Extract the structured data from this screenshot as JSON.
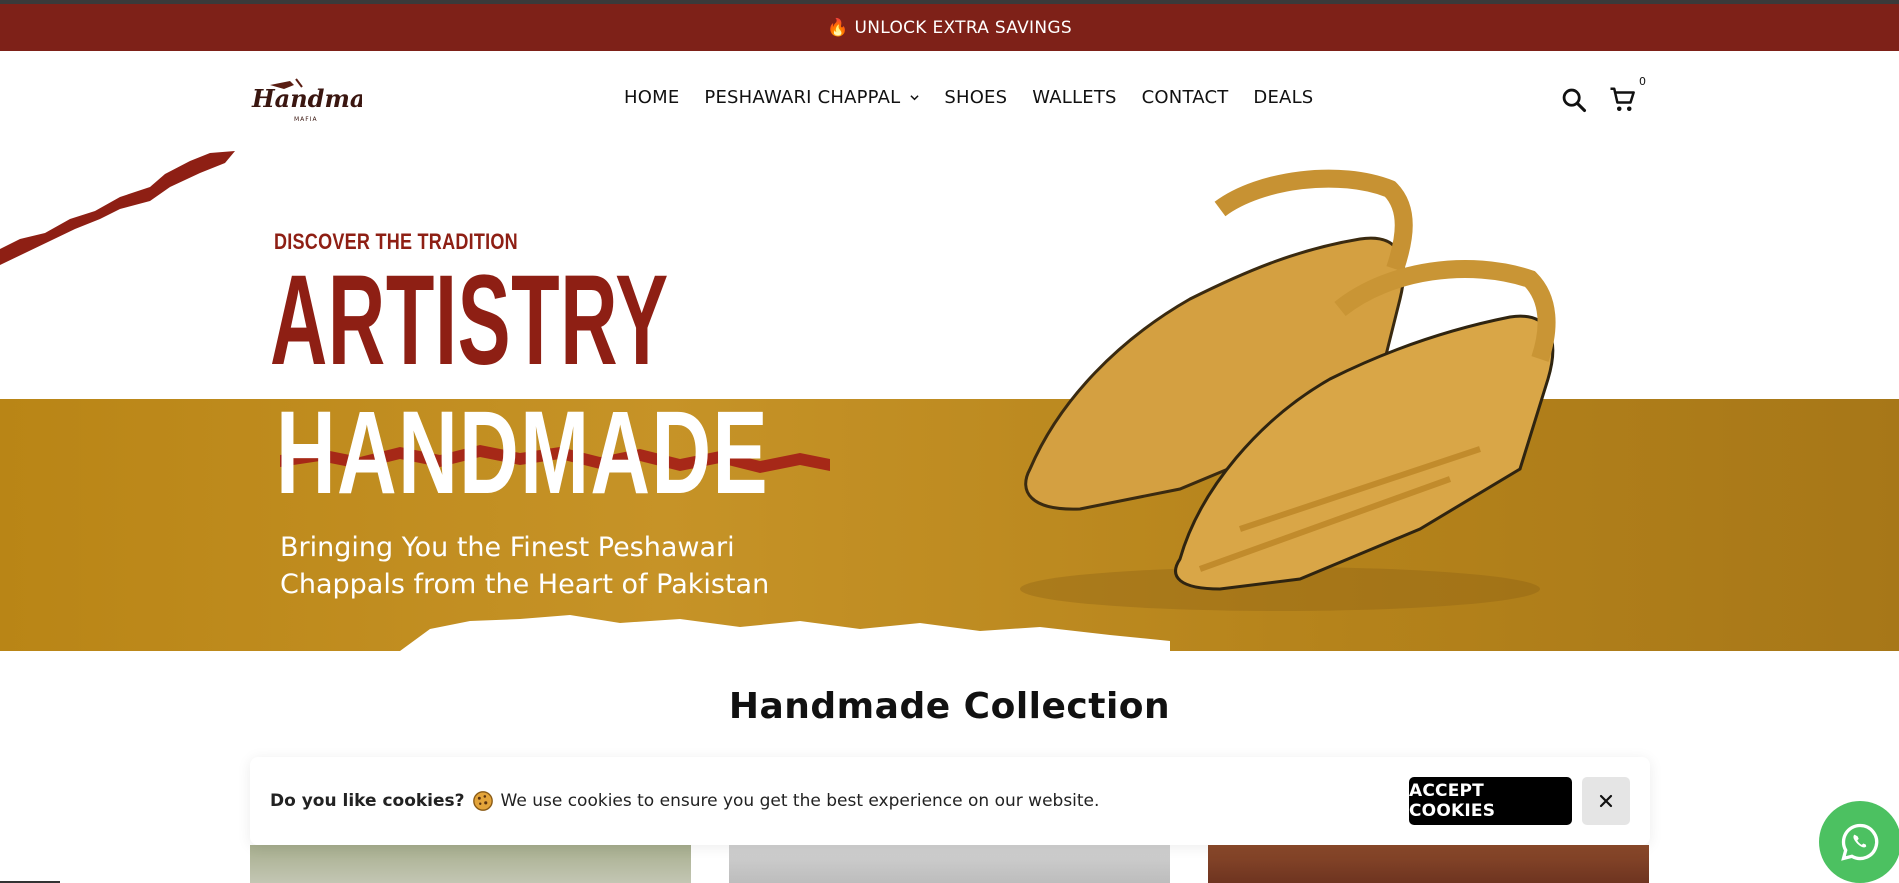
{
  "announcement": {
    "icon": "flame-icon",
    "text": "UNLOCK EXTRA SAVINGS"
  },
  "header": {
    "logo": {
      "text": "Handmade",
      "subtext": "MAFIA"
    },
    "nav": [
      {
        "label": "HOME"
      },
      {
        "label": "PESHAWARI CHAPPAL",
        "has_dropdown": true
      },
      {
        "label": "SHOES"
      },
      {
        "label": "WALLETS"
      },
      {
        "label": "CONTACT"
      },
      {
        "label": "DEALS"
      }
    ],
    "cart_count": "0"
  },
  "hero": {
    "eyebrow": "DISCOVER THE TRADITION",
    "title": "ARTISTRY",
    "subtitle": "HANDMADE",
    "description": "Bringing You the Finest Peshawari Chappals from the Heart of Pakistan"
  },
  "collection": {
    "title": "Handmade Collection"
  },
  "cookie_banner": {
    "question": "Do you like cookies?",
    "message": "We use cookies to ensure you get the best experience on our website.",
    "accept_label": "ACCEPT COOKIES"
  },
  "colors": {
    "announcement_bg": "#7e2118",
    "brand_red": "#8e1f14",
    "hero_band": "#b98516",
    "whatsapp": "#4cc161"
  }
}
